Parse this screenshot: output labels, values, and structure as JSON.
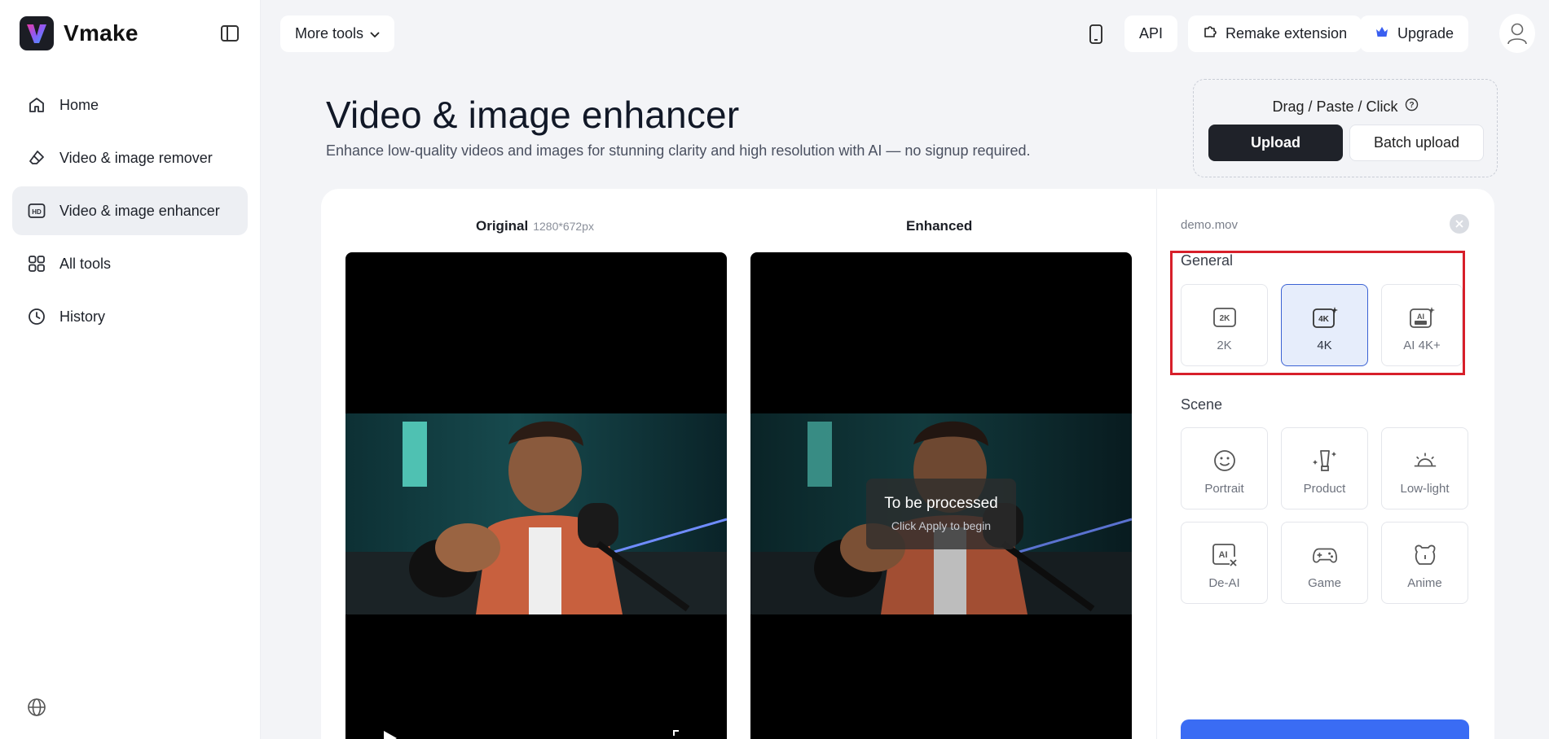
{
  "app": {
    "name": "Vmake"
  },
  "sidebar": {
    "items": [
      {
        "label": "Home",
        "icon": "home-icon",
        "active": false
      },
      {
        "label": "Video & image remover",
        "icon": "eraser-icon",
        "active": false
      },
      {
        "label": "Video & image enhancer",
        "icon": "hd-icon",
        "active": true
      },
      {
        "label": "All tools",
        "icon": "grid-icon",
        "active": false
      },
      {
        "label": "History",
        "icon": "clock-icon",
        "active": false
      }
    ]
  },
  "topbar": {
    "more_tools": "More tools",
    "api": "API",
    "remake_extension": "Remake extension",
    "upgrade": "Upgrade"
  },
  "header": {
    "title": "Video & image enhancer",
    "subtitle": "Enhance low-quality videos and images for stunning clarity and high resolution with AI — no signup required."
  },
  "upload": {
    "drag_label": "Drag / Paste / Click",
    "upload_button": "Upload",
    "batch_button": "Batch upload"
  },
  "preview": {
    "original_label": "Original",
    "original_dims": "1280*672px",
    "enhanced_label": "Enhanced",
    "overlay_title": "To be processed",
    "overlay_sub": "Click Apply to begin"
  },
  "settings": {
    "filename": "demo.mov",
    "general_label": "General",
    "general_options": [
      {
        "label": "2K",
        "icon": "2k-icon",
        "selected": false
      },
      {
        "label": "4K",
        "icon": "4k-icon",
        "selected": true
      },
      {
        "label": "AI 4K+",
        "icon": "ai-ultra-icon",
        "selected": false
      }
    ],
    "scene_label": "Scene",
    "scene_options": [
      {
        "label": "Portrait",
        "icon": "smiley-icon"
      },
      {
        "label": "Product",
        "icon": "product-icon"
      },
      {
        "label": "Low-light",
        "icon": "sunrise-icon"
      },
      {
        "label": "De-AI",
        "icon": "de-ai-icon"
      },
      {
        "label": "Game",
        "icon": "gamepad-icon"
      },
      {
        "label": "Anime",
        "icon": "bear-icon"
      }
    ]
  },
  "colors": {
    "accent": "#3a6cf4",
    "highlight": "#d71f2a",
    "dark_button": "#1f2229",
    "selected_bg": "#e6edfb"
  }
}
